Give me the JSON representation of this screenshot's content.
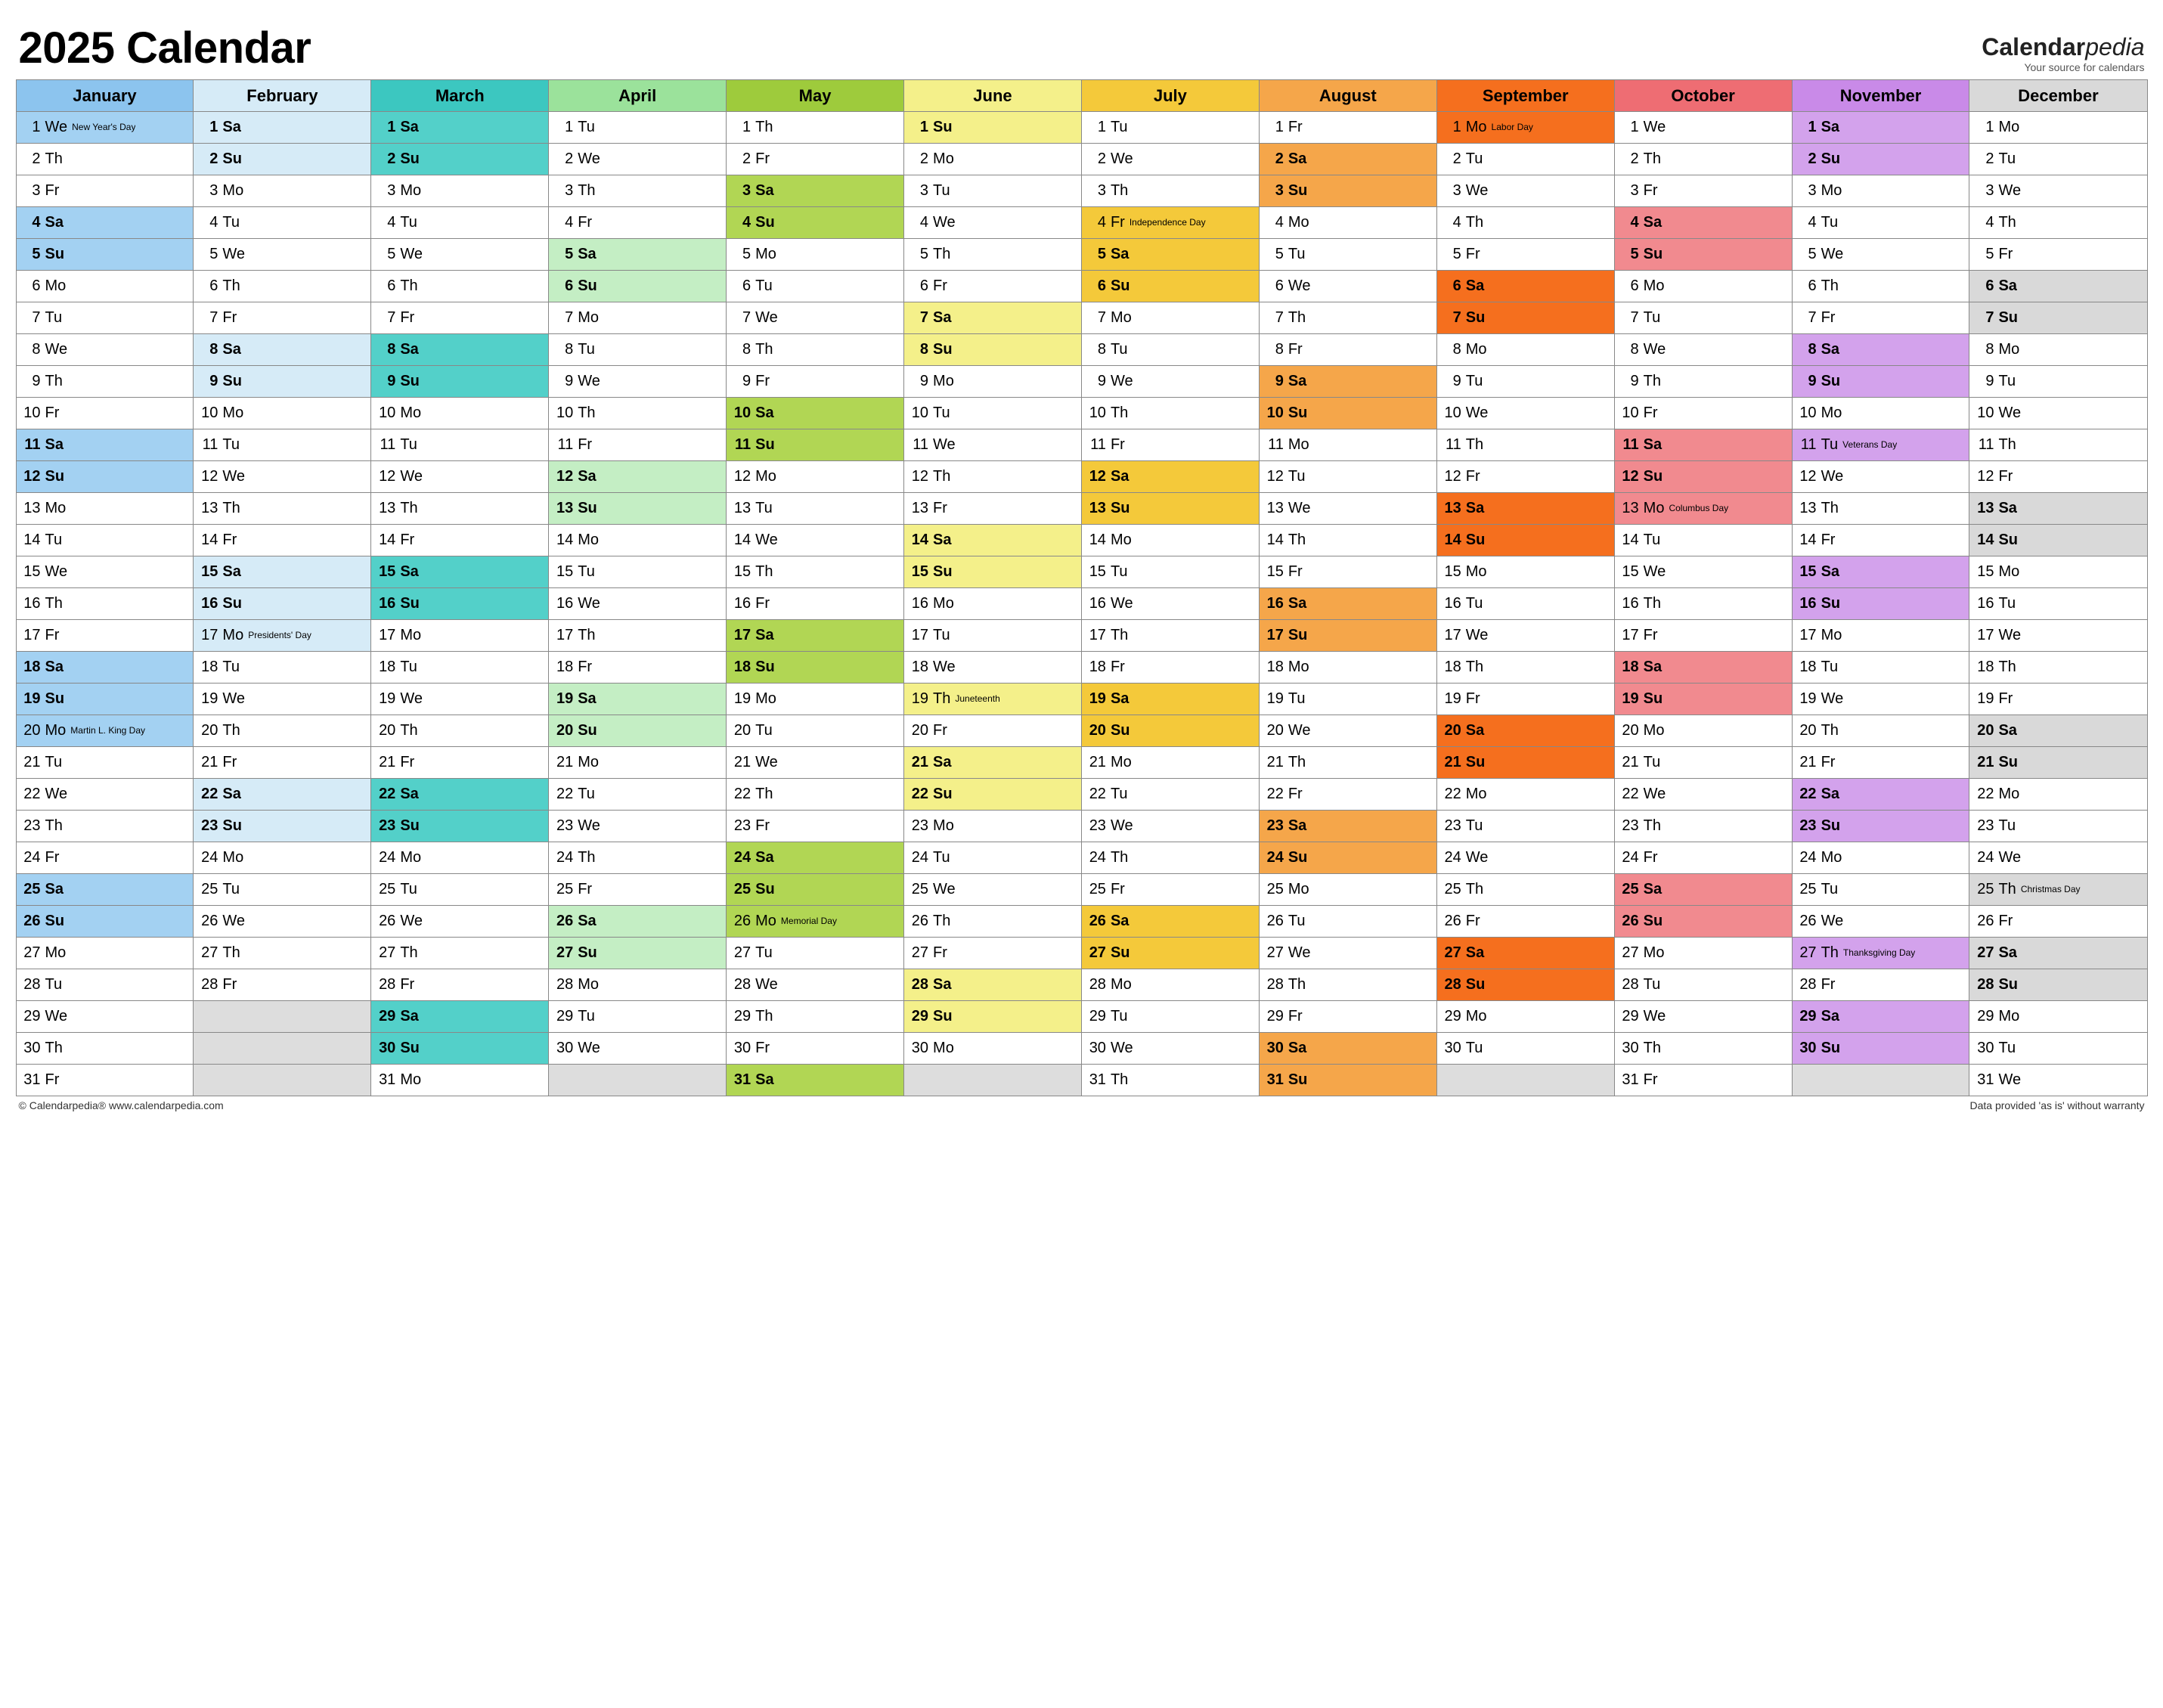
{
  "title": "2025 Calendar",
  "brand": {
    "name1": "Calendar",
    "name2": "pedia",
    "tagline": "Your source for calendars"
  },
  "footer": {
    "left": "© Calendarpedia®   www.calendarpedia.com",
    "right": "Data provided 'as is' without warranty"
  },
  "months": [
    {
      "name": "January",
      "header_bg": "#8cc4ee",
      "we_bg": "#a3d1f2"
    },
    {
      "name": "February",
      "header_bg": "#d6ebf7",
      "we_bg": "#d6ebf7"
    },
    {
      "name": "March",
      "header_bg": "#3cc7c0",
      "we_bg": "#53d0c9"
    },
    {
      "name": "April",
      "header_bg": "#9be29b",
      "we_bg": "#c4eec4"
    },
    {
      "name": "May",
      "header_bg": "#9ecb3c",
      "we_bg": "#b1d654"
    },
    {
      "name": "June",
      "header_bg": "#f4f08a",
      "we_bg": "#f4f08a"
    },
    {
      "name": "July",
      "header_bg": "#f4c93a",
      "we_bg": "#f4c93a"
    },
    {
      "name": "August",
      "header_bg": "#f5a64a",
      "we_bg": "#f5a64a"
    },
    {
      "name": "September",
      "header_bg": "#f56f1e",
      "we_bg": "#f56f1e"
    },
    {
      "name": "October",
      "header_bg": "#ee6d73",
      "we_bg": "#f18a8f"
    },
    {
      "name": "November",
      "header_bg": "#c98ae8",
      "we_bg": "#d3a2ec"
    },
    {
      "name": "December",
      "header_bg": "#d9d9d9",
      "we_bg": "#d9d9d9"
    }
  ],
  "start_weekday": [
    3,
    6,
    6,
    2,
    4,
    0,
    2,
    5,
    1,
    3,
    6,
    1
  ],
  "month_length": [
    31,
    28,
    31,
    30,
    31,
    30,
    31,
    31,
    30,
    31,
    30,
    31
  ],
  "weekday_abbr": [
    "Su",
    "Mo",
    "Tu",
    "We",
    "Th",
    "Fr",
    "Sa"
  ],
  "holidays": {
    "0": {
      "1": "New Year's Day",
      "20": "Martin L. King Day"
    },
    "1": {
      "17": "Presidents' Day"
    },
    "4": {
      "26": "Memorial Day"
    },
    "5": {
      "19": "Juneteenth"
    },
    "6": {
      "4": "Independence Day"
    },
    "8": {
      "1": "Labor Day"
    },
    "9": {
      "13": "Columbus Day"
    },
    "10": {
      "11": "Veterans Day",
      "27": "Thanksgiving Day"
    },
    "11": {
      "25": "Christmas Day"
    }
  }
}
